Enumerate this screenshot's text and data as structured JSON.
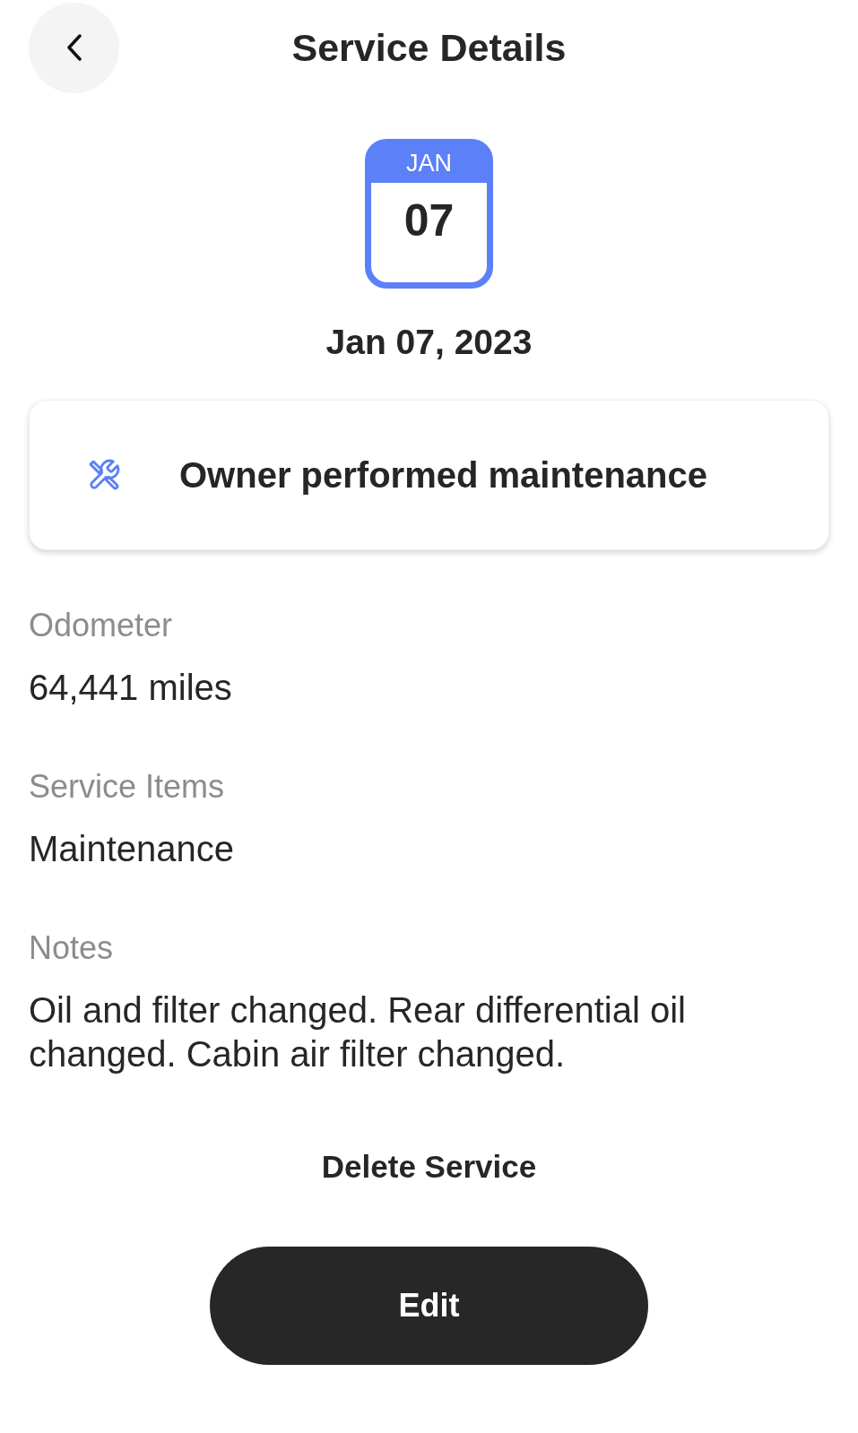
{
  "header": {
    "title": "Service Details"
  },
  "date_badge": {
    "month": "JAN",
    "day": "07"
  },
  "date": "Jan 07, 2023",
  "service_type": {
    "label": "Owner performed maintenance"
  },
  "fields": [
    {
      "label": "Odometer",
      "value": "64,441 miles"
    },
    {
      "label": "Service Items",
      "value": "Maintenance"
    },
    {
      "label": "Notes",
      "value": "Oil and filter changed. Rear differential oil changed. Cabin air filter changed."
    }
  ],
  "actions": [
    {
      "kind": "text",
      "label": "Delete Service"
    },
    {
      "kind": "primary",
      "label": "Edit"
    }
  ]
}
